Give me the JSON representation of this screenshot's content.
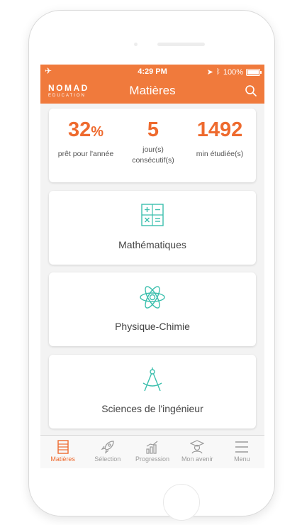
{
  "status_bar": {
    "time": "4:29 PM",
    "battery": "100%"
  },
  "nav": {
    "logo_line1": "NOMAD",
    "logo_line2": "EDUCATION",
    "title": "Matières"
  },
  "stats": [
    {
      "value": "32",
      "unit": "%",
      "label": "prêt pour l'année"
    },
    {
      "value": "5",
      "unit": "",
      "label_line1": "jour(s)",
      "label_line2": "consécutif(s)"
    },
    {
      "value": "1492",
      "unit": "",
      "label": "min étudiée(s)"
    }
  ],
  "subjects": [
    {
      "name": "Mathématiques",
      "icon": "calculator-icon"
    },
    {
      "name": "Physique-Chimie",
      "icon": "atom-icon"
    },
    {
      "name": "Sciences de l'ingénieur",
      "icon": "compass-icon"
    }
  ],
  "tabs": [
    {
      "label": "Matières",
      "icon": "books-icon",
      "active": true
    },
    {
      "label": "Sélection",
      "icon": "rocket-icon",
      "active": false
    },
    {
      "label": "Progression",
      "icon": "chart-icon",
      "active": false
    },
    {
      "label": "Mon avenir",
      "icon": "graduate-icon",
      "active": false
    },
    {
      "label": "Menu",
      "icon": "hamburger-icon",
      "active": false
    }
  ],
  "colors": {
    "brand": "#f07a3c",
    "accent_number": "#ee6a2e",
    "icon_teal": "#3bbfad",
    "tab_inactive": "#9b9b9b"
  }
}
